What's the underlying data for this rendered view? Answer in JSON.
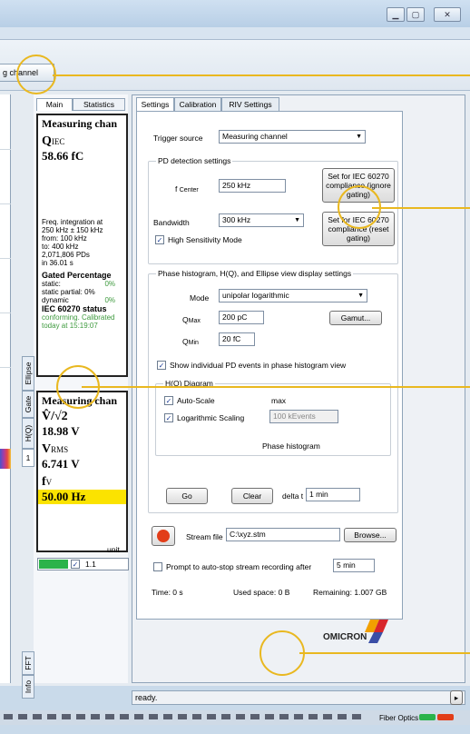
{
  "window": {
    "minimize_icon": "minimize-icon",
    "maximize_icon": "maximize-icon",
    "close_icon": "close-icon"
  },
  "channel_tab": {
    "label": "g channel"
  },
  "left_panel": {
    "tabs": [
      "Main",
      "Statistics"
    ],
    "vertical_tabs": [
      "Ellipse",
      "Gate",
      "H(Q)",
      "1",
      "FFT",
      "Info"
    ],
    "box1": {
      "title": "Measuring chan",
      "q_symbol": "Q",
      "q_sub": "IEC",
      "q_value": "58.66 fC",
      "freq_line1": "Freq. integration at",
      "freq_line2": "250 kHz ± 150 kHz",
      "from": "from:  100 kHz",
      "to": "to:     400 kHz",
      "pds": "2,071,806 PDs",
      "time": "in 36.01 s",
      "gated_title": "Gated Percentage",
      "static_label": "static:",
      "static_value": "0%",
      "static_partial": "static partial: 0%",
      "dynamic_label": "dynamic",
      "dynamic_value": "0%",
      "iec_status_title": "IEC 60270 status",
      "iec_status_line1": "conforming. Calibrated",
      "iec_status_line2": "today at 15:19:07"
    },
    "box2": {
      "title": "Measuring chan",
      "vpk_label": "V̂/√2",
      "vpk_value": "18.98 V",
      "vrms_label": "V",
      "vrms_sub": "RMS",
      "vrms_value": "6.741 V",
      "fv_label": "f",
      "fv_sub": "V",
      "fv_value": "50.00 Hz"
    },
    "unit_label": "unit",
    "unit_value": "1.1"
  },
  "settings": {
    "tabs": [
      "Settings",
      "Calibration",
      "RIV Settings"
    ],
    "trigger_source_label": "Trigger source",
    "trigger_source_value": "Measuring channel",
    "pd_group_title": "PD detection settings",
    "fcenter_label": "f",
    "fcenter_sub": "Center",
    "fcenter_value": "250 kHz",
    "bandwidth_label": "Bandwidth",
    "bandwidth_value": "300 kHz",
    "hs_mode_label": "High Sensitivity Mode",
    "iec_btn1": "Set for IEC 60270 compliance (ignore gating)",
    "iec_btn2": "Set for IEC 60270 compliance (reset gating)",
    "phase_group_title": "Phase histogram, H(Q), and Ellipse view display settings",
    "mode_label": "Mode",
    "mode_value": "unipolar logarithmic",
    "qmax_label": "Q",
    "qmax_sub": "Max",
    "qmax_value": "200 pC",
    "qmin_label": "Q",
    "qmin_sub": "Min",
    "qmin_value": "20 fC",
    "gamut_label": "Gamut...",
    "show_individual_label": "Show individual PD events in phase histogram view",
    "hq_group_title": "H(Q) Diagram",
    "autoscale_label": "Auto-Scale",
    "max_label": "max",
    "log_scaling_label": "Logarithmic Scaling",
    "kevents_value": "100 kEvents",
    "phase_hist_label": "Phase histogram",
    "go_label": "Go",
    "clear_label": "Clear",
    "delta_t_label": "delta t",
    "delta_t_value": "1 min",
    "stream_file_label": "Stream file",
    "stream_file_value": "C:\\xyz.stm",
    "browse_label": "Browse...",
    "autostop_label": "Prompt to auto-stop stream recording after",
    "autostop_value": "5 min",
    "time_label": "Time: 0 s",
    "used_space_label": "Used space: 0 B",
    "remaining_label": "Remaining: 1.007 GB",
    "brand": "OMICRON"
  },
  "status": {
    "text": "ready.",
    "fiber_optics_label": "Fiber Optics"
  },
  "colors": {
    "callout": "#e9b820",
    "record": "#e23d18",
    "fiber_green": "#2bb34a",
    "fiber_red": "#e23d18",
    "highlight_yellow": "#fbe300"
  }
}
